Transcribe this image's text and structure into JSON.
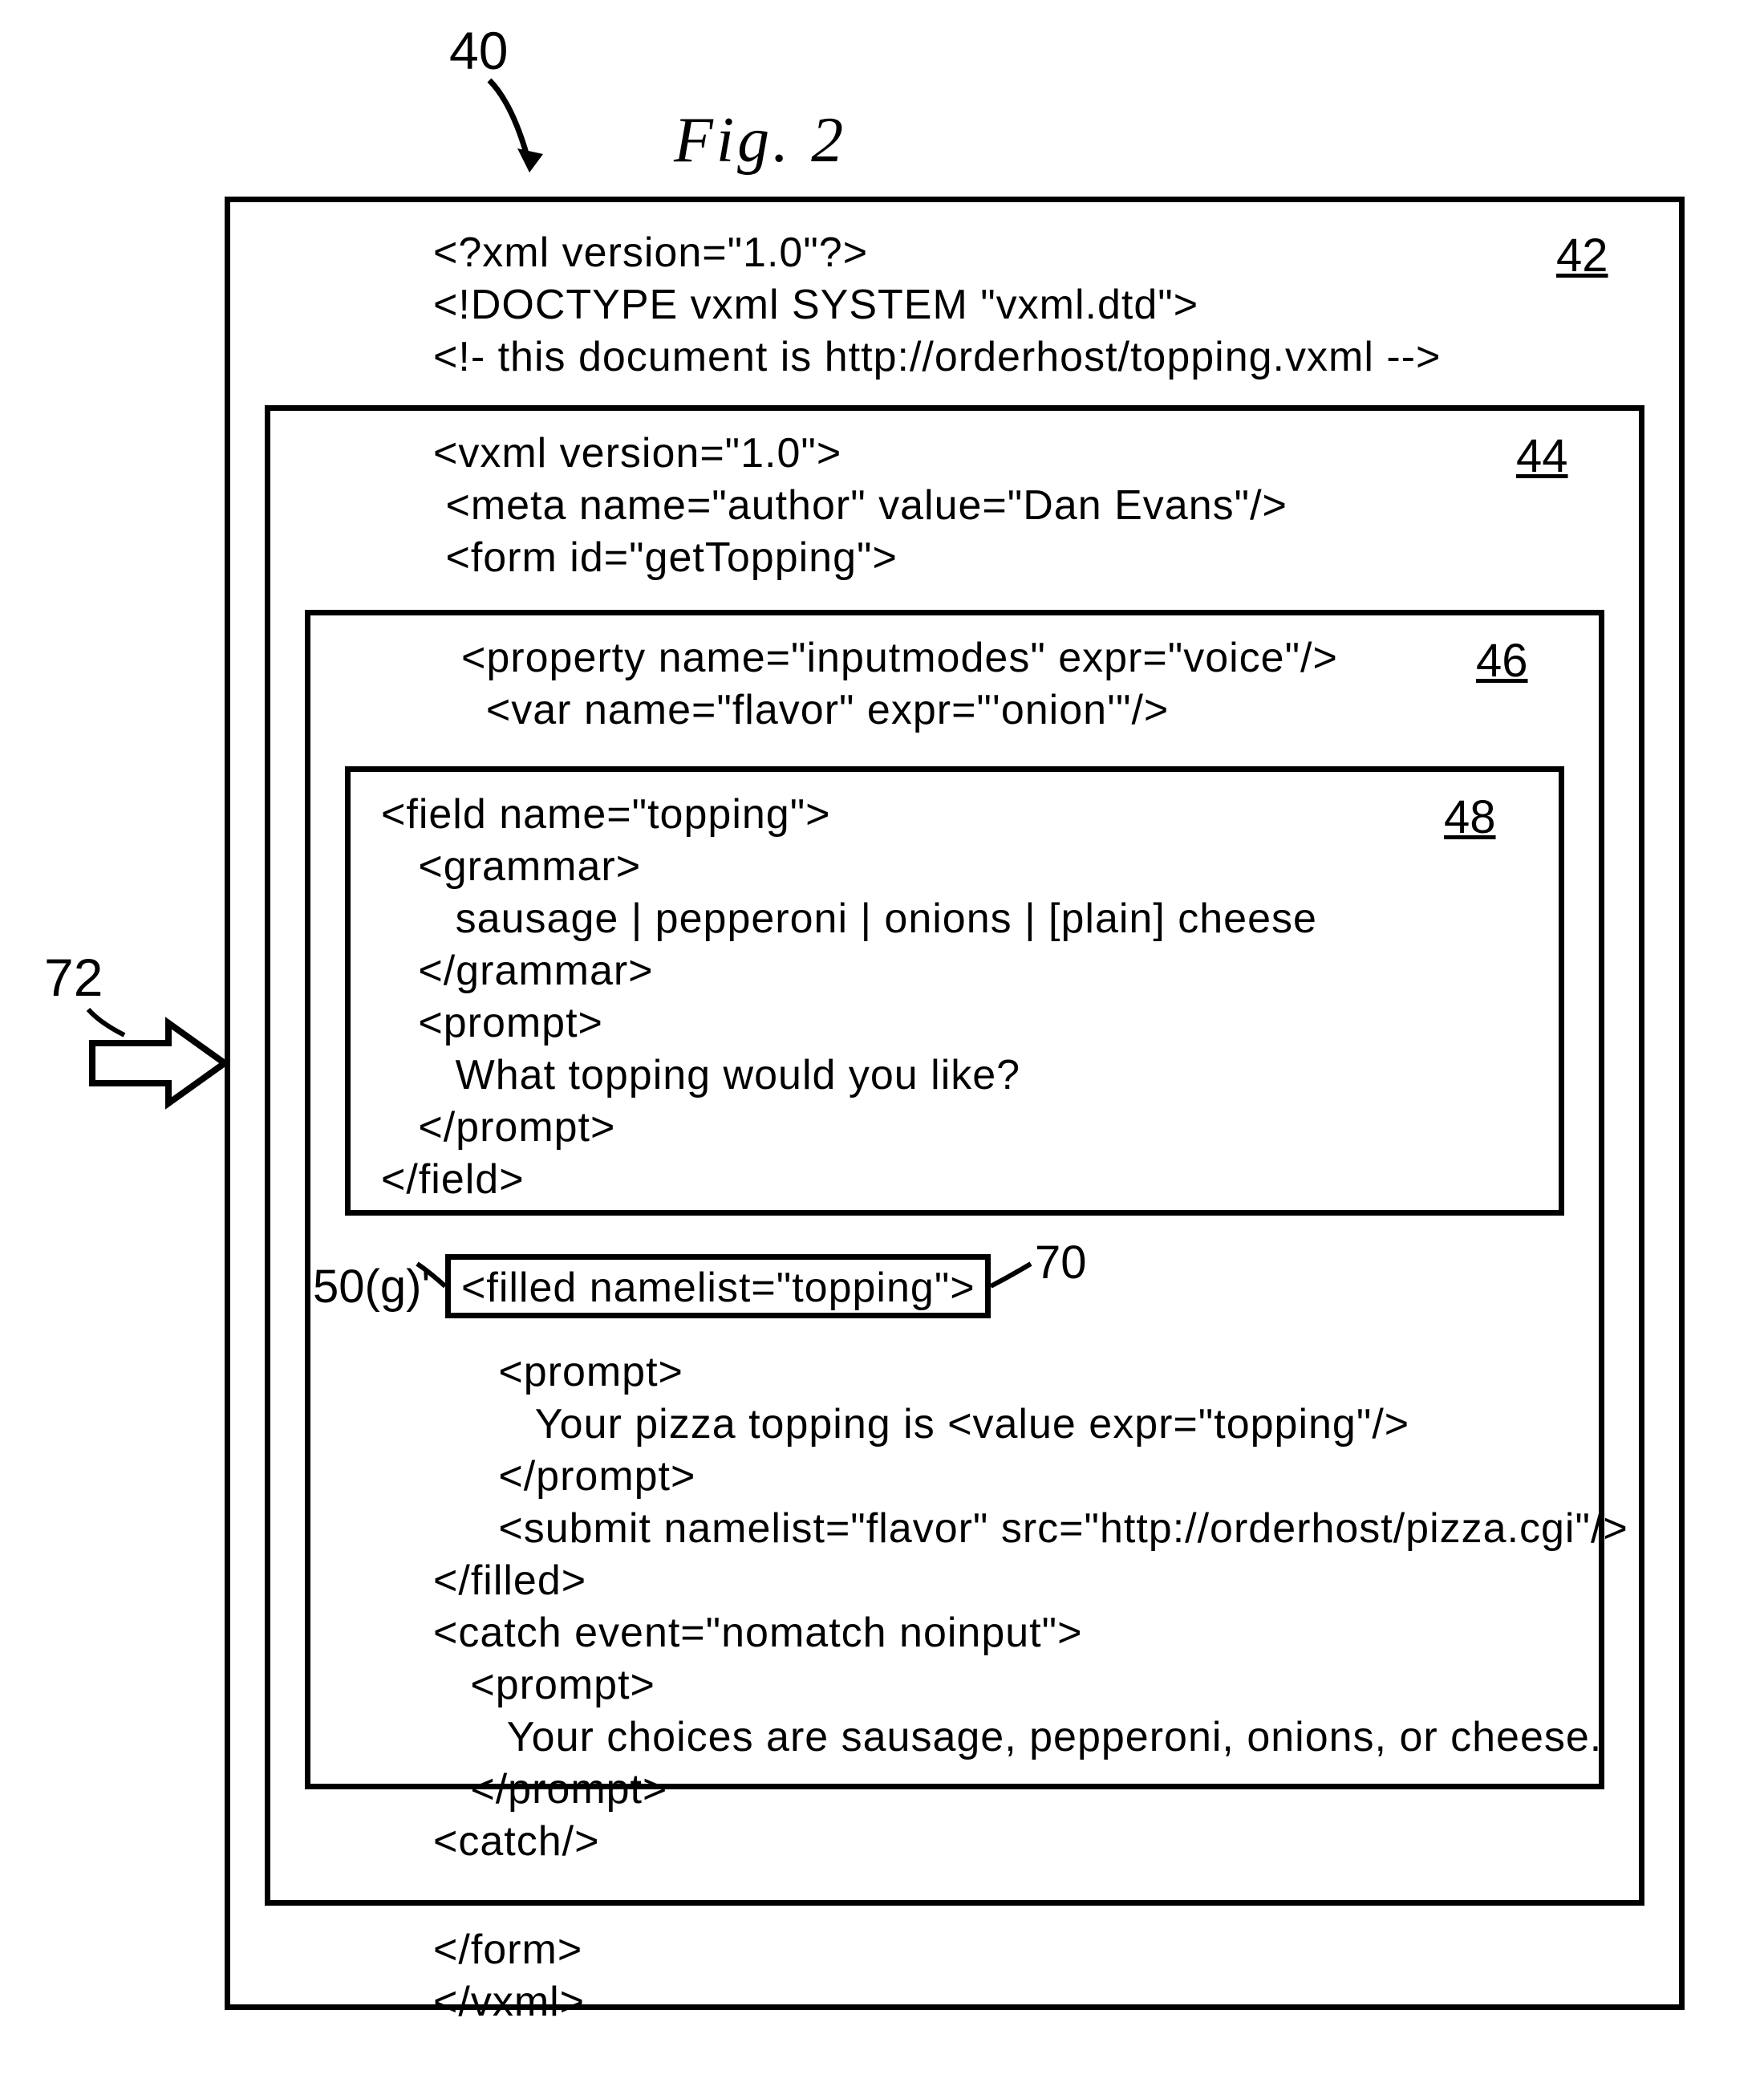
{
  "figure_title": "Fig.  2",
  "labels": {
    "outer_ref": "40",
    "arrow_ref": "72",
    "ref42": "42",
    "ref44": "44",
    "ref46": "46",
    "ref48": "48",
    "ref50g": "50(g)'",
    "ref70": "70"
  },
  "code": {
    "l01": "<?xml version=\"1.0\"?>",
    "l02": "<!DOCTYPE vxml SYSTEM \"vxml.dtd\">",
    "l03": "<!- this document is http://orderhost/topping.vxml -->",
    "l04": "<vxml version=\"1.0\">",
    "l05": " <meta name=\"author\" value=\"Dan Evans\"/>",
    "l06": " <form id=\"getTopping\">",
    "l07": "<property name=\"inputmodes\" expr=\"voice\"/>",
    "l08": "  <var name=\"flavor\" expr=\"'onion'\"/>",
    "l09": "<field name=\"topping\">",
    "l10": "   <grammar>",
    "l11": "      sausage | pepperoni | onions | [plain] cheese",
    "l12": "   </grammar>",
    "l13": "   <prompt>",
    "l14": "      What topping would you like?",
    "l15": "   </prompt>",
    "l16": "</field>",
    "l17": "<filled namelist=\"topping\">",
    "l18": "   <prompt>",
    "l19": "      Your pizza topping is <value expr=\"topping\"/>",
    "l20": "   </prompt>",
    "l21": "   <submit namelist=\"flavor\" src=\"http://orderhost/pizza.cgi\"/>",
    "l22": "</filled>",
    "l23": "<catch event=\"nomatch noinput\">",
    "l24": "   <prompt>",
    "l25": "      Your choices are sausage, pepperoni, onions, or cheese.",
    "l26": "   </prompt>",
    "l27": "<catch/>",
    "l28": "</form>",
    "l29": "</vxml>"
  }
}
